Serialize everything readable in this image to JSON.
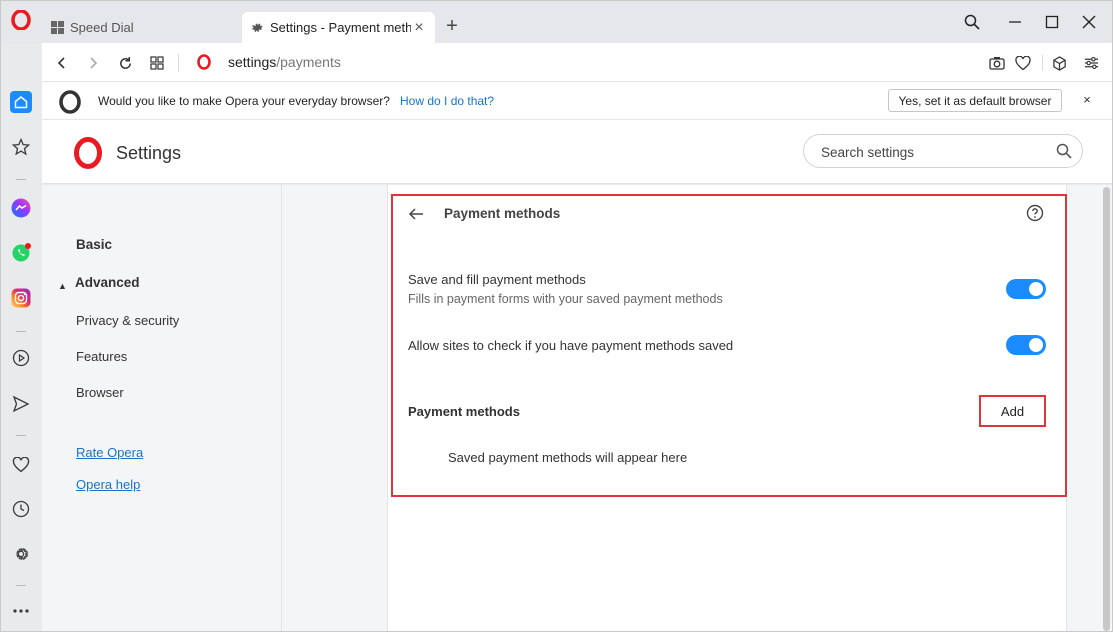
{
  "tabs": [
    {
      "label": "Speed Dial",
      "icon": "speed-dial-icon",
      "active": false
    },
    {
      "label": "Settings - Payment methods",
      "icon": "gear-icon",
      "active": true
    }
  ],
  "address": {
    "host": "settings",
    "path": "/payments"
  },
  "infobar": {
    "message": "Would you like to make Opera your everyday browser?",
    "link": "How do I do that?",
    "button": "Yes, set it as default browser",
    "close": "×"
  },
  "settings": {
    "title": "Settings",
    "search_placeholder": "Search settings"
  },
  "nav": {
    "basic": "Basic",
    "advanced": "Advanced",
    "items": [
      "Privacy & security",
      "Features",
      "Browser"
    ],
    "links": [
      "Rate Opera",
      "Opera help"
    ]
  },
  "payments": {
    "title": "Payment methods",
    "save_fill_label": "Save and fill payment methods",
    "save_fill_sub": "Fills in payment forms with your saved payment methods",
    "save_fill_enabled": true,
    "allow_sites_label": "Allow sites to check if you have payment methods saved",
    "allow_sites_enabled": true,
    "section_title": "Payment methods",
    "add_button": "Add",
    "empty_message": "Saved payment methods will appear here"
  },
  "colors": {
    "accent": "#1a8cff",
    "highlight": "#e0343b",
    "opera_red": "#e81b23",
    "link": "#1a73c8"
  }
}
